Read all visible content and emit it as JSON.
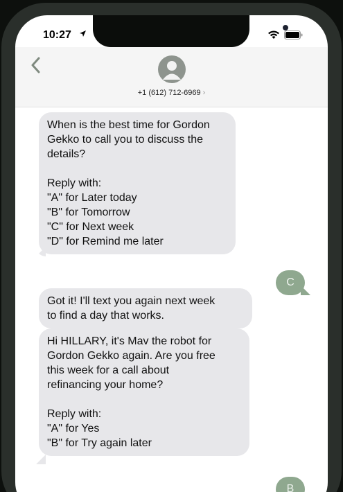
{
  "status": {
    "time": "10:27"
  },
  "header": {
    "contact": "+1 (612) 712-6969",
    "chevron": "›"
  },
  "messages": {
    "m1": "When is the best time for Gordon\nGekko to call you to discuss the\ndetails?\n\nReply with:\n\"A\" for Later today\n\"B\" for Tomorrow\n\"C\" for Next week\n\"D\" for Remind me later",
    "r1": "C",
    "m2": "Got it! I'll text you again next week\nto find a day that works.",
    "m3": "Hi HILLARY, it's Mav the robot for\nGordon Gekko again. Are you free\nthis week for a call about\nrefinancing your home?\n\nReply with:\n\"A\" for Yes\n\"B\" for Try again later",
    "r2": "B"
  },
  "colors": {
    "incoming": "#e7e7ea",
    "outgoing": "#8fa88f"
  },
  "icons": [
    "location-arrow-icon",
    "wifi-icon",
    "battery-icon",
    "back-chevron-icon",
    "person-icon"
  ]
}
